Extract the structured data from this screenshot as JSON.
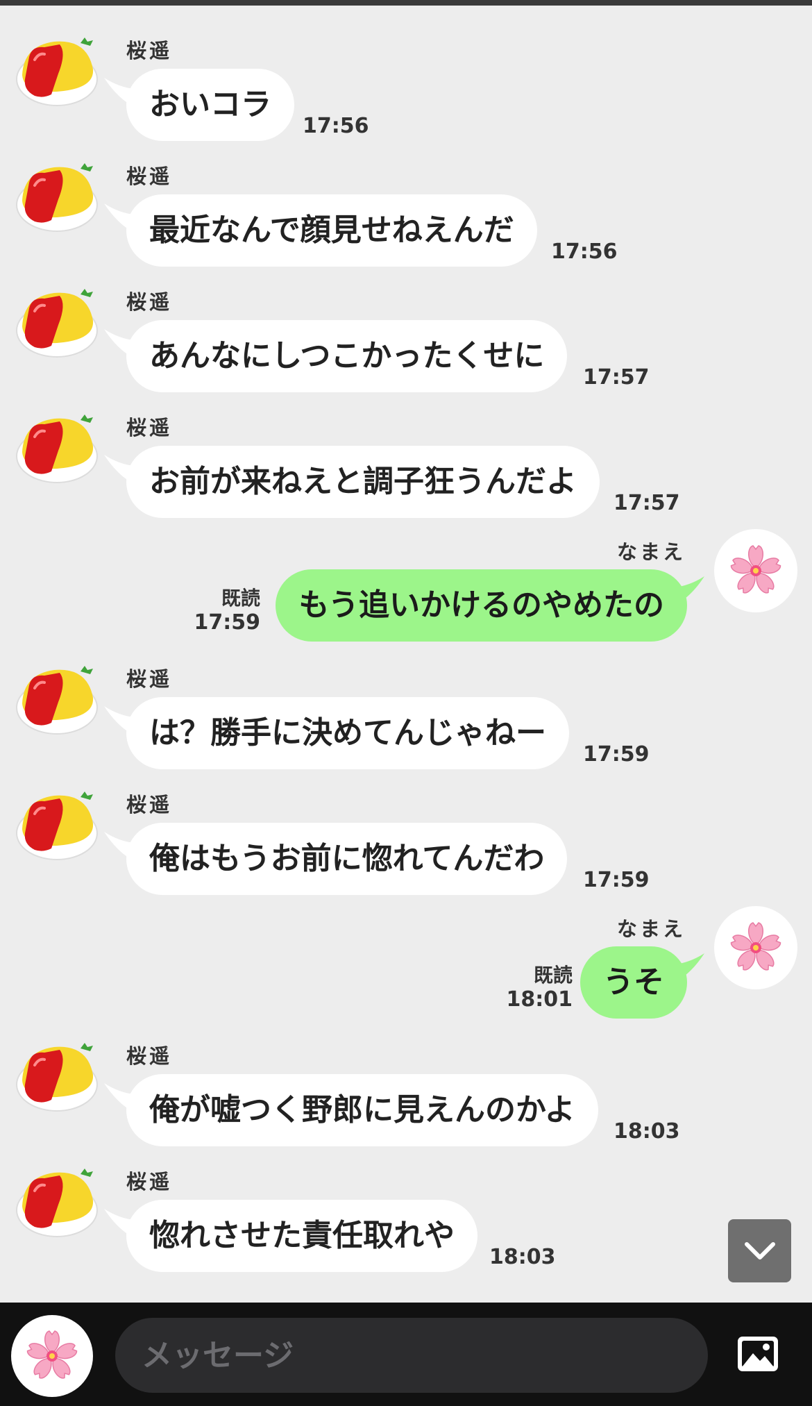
{
  "contact": {
    "name": "桜遥"
  },
  "me": {
    "name": "なまえ",
    "read_label": "既読"
  },
  "messages": [
    {
      "from": "contact",
      "text": "おいコラ",
      "time": "17:56"
    },
    {
      "from": "contact",
      "text": "最近なんで顔見せねえんだ",
      "time": "17:56"
    },
    {
      "from": "contact",
      "text": "あんなにしつこかったくせに",
      "time": "17:57"
    },
    {
      "from": "contact",
      "text": "お前が来ねえと調子狂うんだよ",
      "time": "17:57"
    },
    {
      "from": "me",
      "text": "もう追いかけるのやめたの",
      "time": "17:59",
      "read": "既読"
    },
    {
      "from": "contact",
      "text": "は？勝手に決めてんじゃねー",
      "time": "17:59"
    },
    {
      "from": "contact",
      "text": "俺はもうお前に惚れてんだわ",
      "time": "17:59"
    },
    {
      "from": "me",
      "text": "うそ",
      "time": "18:01",
      "read": "既読"
    },
    {
      "from": "contact",
      "text": "俺が嘘つく野郎に見えんのかよ",
      "time": "18:03"
    },
    {
      "from": "contact",
      "text": "惚れさせた責任取れや",
      "time": "18:03"
    }
  ],
  "composer": {
    "placeholder": "メッセージ"
  },
  "icons": {
    "contact_avatar": "omelet-icon",
    "my_avatar": "cherry-blossom-icon",
    "scroll": "chevron-down-icon",
    "attach": "image-icon"
  },
  "colors": {
    "background": "#ededed",
    "incoming_bubble": "#ffffff",
    "outgoing_bubble": "#9cf58a",
    "bottom_bar": "#111111",
    "input_bg": "#2c2c2e"
  }
}
